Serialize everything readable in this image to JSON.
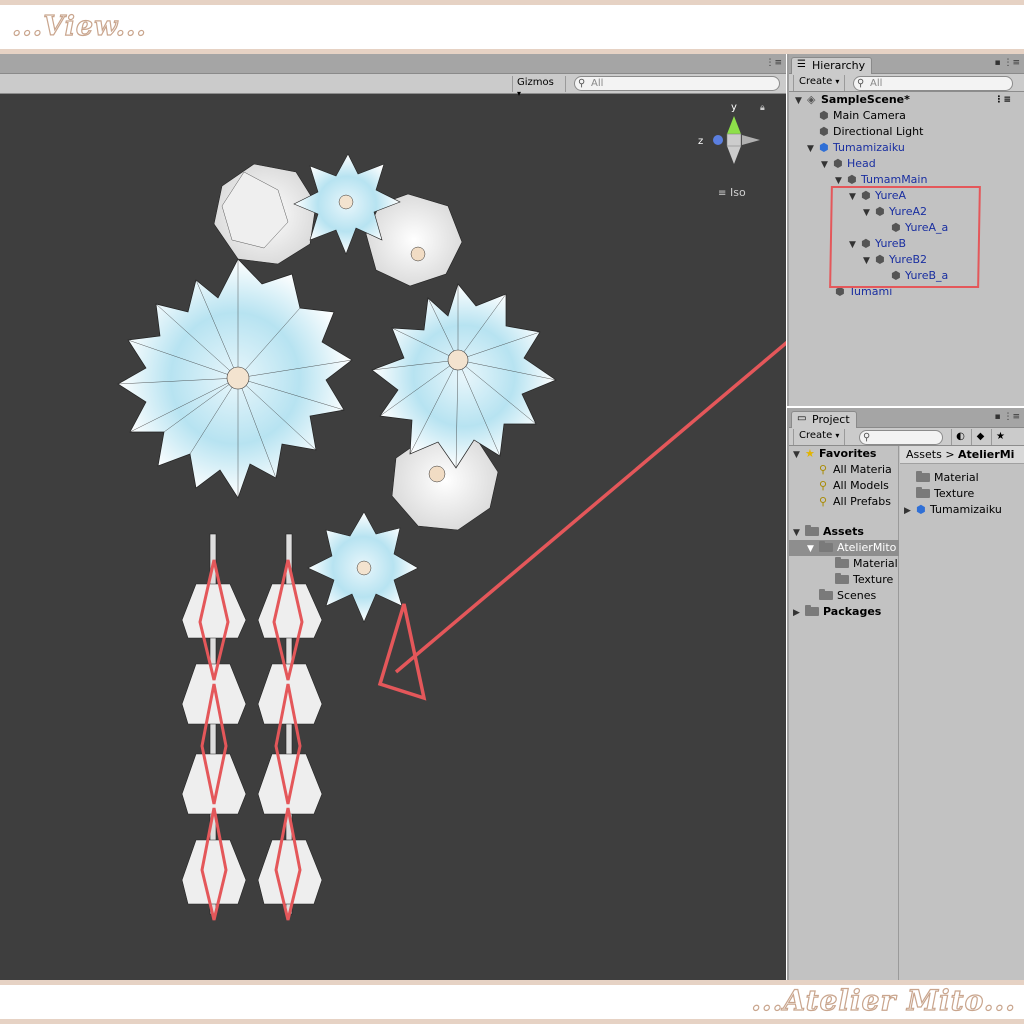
{
  "banners": {
    "top": "...View...",
    "bottom": "...Atelier Mito..."
  },
  "scene": {
    "gizmos_label": "Gizmos",
    "search_placeholder": "All",
    "axis_y": "y",
    "axis_z": "z",
    "projection": "Iso"
  },
  "hierarchy": {
    "tab_label": "Hierarchy",
    "create_label": "Create",
    "search_placeholder": "All",
    "scene_name": "SampleScene*",
    "items": [
      {
        "label": "Main Camera"
      },
      {
        "label": "Directional Light"
      },
      {
        "label": "Tumamizaiku"
      },
      {
        "label": "Head"
      },
      {
        "label": "TumamMain"
      },
      {
        "label": "YureA"
      },
      {
        "label": "YureA2"
      },
      {
        "label": "YureA_a"
      },
      {
        "label": "YureB"
      },
      {
        "label": "YureB2"
      },
      {
        "label": "YureB_a"
      },
      {
        "label": "Tumami"
      }
    ]
  },
  "project": {
    "tab_label": "Project",
    "create_label": "Create",
    "favorites_label": "Favorites",
    "favorites": [
      {
        "label": "All Materia"
      },
      {
        "label": "All Models"
      },
      {
        "label": "All Prefabs"
      }
    ],
    "assets_label": "Assets",
    "assets_tree": [
      {
        "label": "AtelierMito"
      },
      {
        "label": "Material"
      },
      {
        "label": "Texture"
      },
      {
        "label": "Scenes"
      },
      {
        "label": "Packages"
      }
    ],
    "breadcrumb": {
      "root": "Assets",
      "sep": ">",
      "current": "AtelierMi"
    },
    "contents": [
      {
        "label": "Material"
      },
      {
        "label": "Texture"
      },
      {
        "label": "Tumamizaiku"
      }
    ]
  },
  "colors": {
    "banner_accent": "#c9a58d",
    "scene_bg": "#3e3e3e",
    "annotation_red": "#e4575a",
    "petal_blue": "#a9dcec",
    "hierarchy_blue": "#1a2fa0"
  }
}
